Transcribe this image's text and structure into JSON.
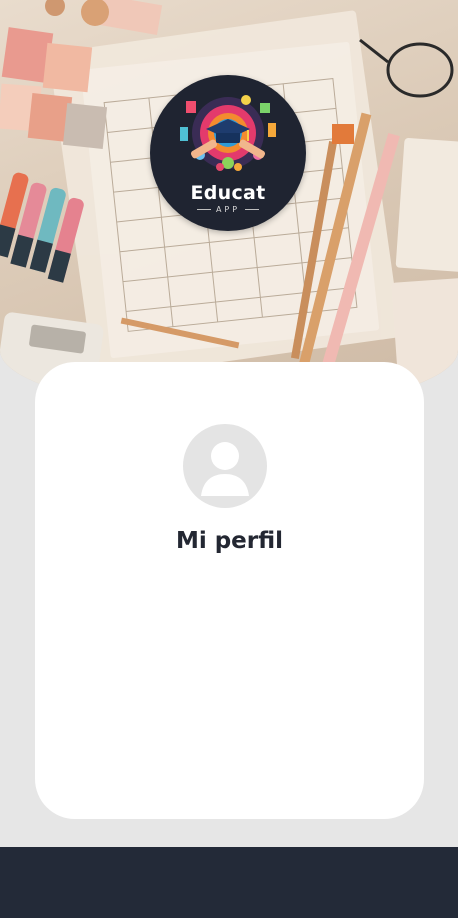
{
  "app": {
    "logo_title": "Educat",
    "logo_subtitle": "APP"
  },
  "profile": {
    "title": "Mi perfil",
    "avatar_icon": "user-avatar-icon"
  },
  "colors": {
    "background": "#e6e6e6",
    "card": "#ffffff",
    "title_text": "#232732",
    "bottom_bar": "#232a38",
    "logo_background": "#1f2431"
  }
}
